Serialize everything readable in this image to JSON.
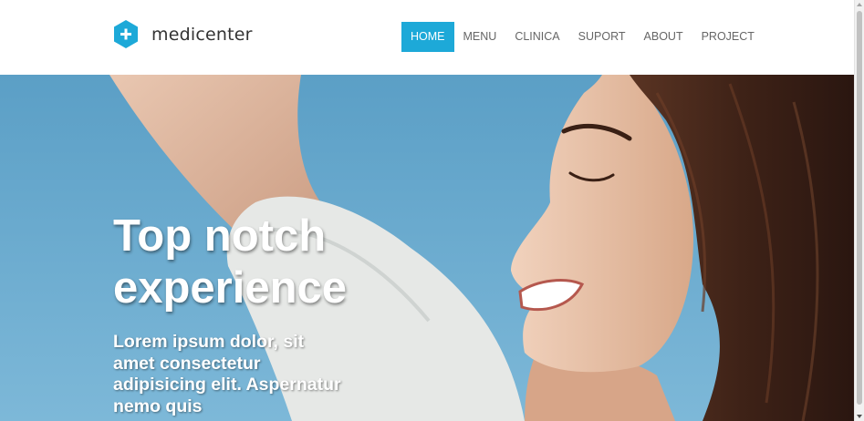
{
  "brand": {
    "name": "medicenter",
    "logo_icon": "hexagon-plus-icon",
    "accent_color": "#1da9d8"
  },
  "nav": {
    "items": [
      {
        "label": "HOME",
        "active": true
      },
      {
        "label": "MENU",
        "active": false
      },
      {
        "label": "CLINICA",
        "active": false
      },
      {
        "label": "SUPORT",
        "active": false
      },
      {
        "label": "ABOUT",
        "active": false
      },
      {
        "label": "PROJECT",
        "active": false
      }
    ]
  },
  "hero": {
    "title": "Top notch experience",
    "text": "Lorem ipsum dolor, sit amet consectetur adipisicing elit. Aspernatur nemo quis",
    "image": "smiling-woman-sky-photo"
  },
  "scrollbar": {
    "icon_up": "scroll-up-arrow-icon",
    "icon_down": "scroll-down-arrow-icon"
  }
}
